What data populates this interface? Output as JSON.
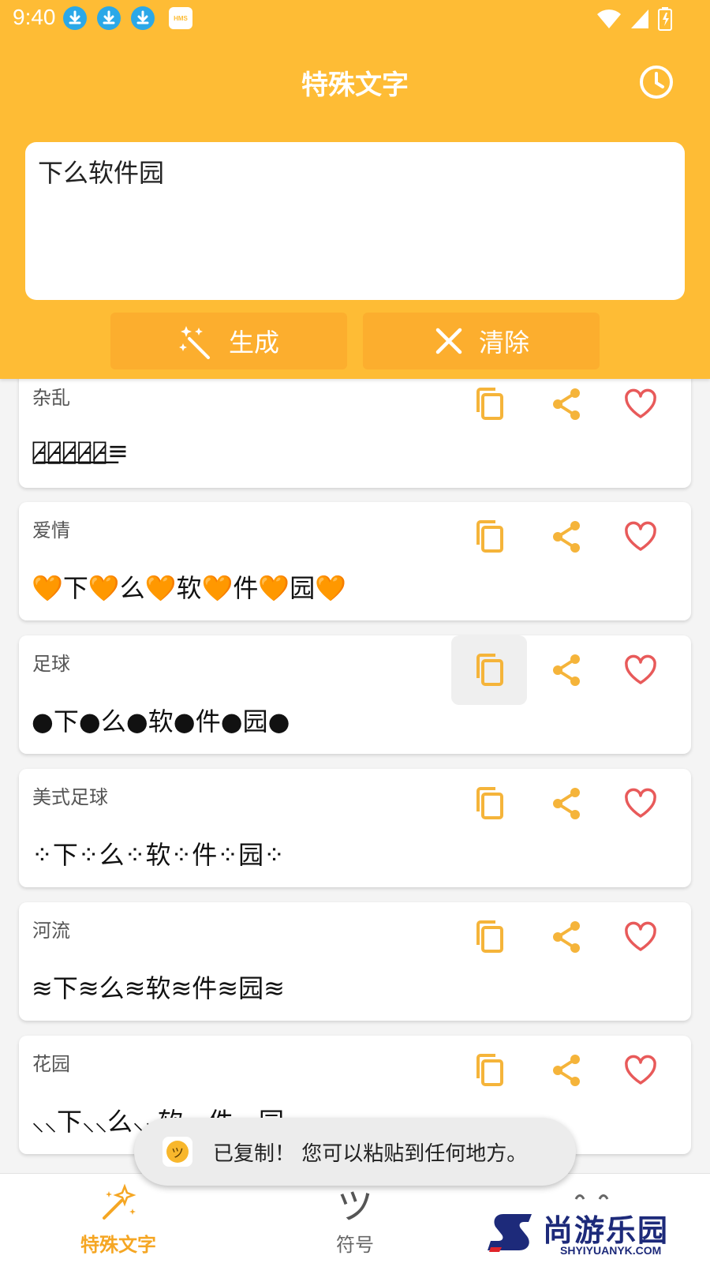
{
  "status_bar": {
    "time": "9:40",
    "hms_label": "HMS"
  },
  "header": {
    "title": "特殊文字"
  },
  "input": {
    "value": "下么软件园"
  },
  "actions": {
    "generate_label": "生成",
    "clear_label": "清除"
  },
  "cards": [
    {
      "label": "杂乱",
      "text": "下̷̵͟么̷̵͟软̷̵͟件̷̵͟园̷̵͟≡"
    },
    {
      "label": "爱情",
      "text": "🧡下🧡么🧡软🧡件🧡园🧡"
    },
    {
      "label": "足球",
      "text": "●下●么●软●件●园●"
    },
    {
      "label": "美式足球",
      "text": "⁘下⁘么⁘软⁘件⁘园⁘"
    },
    {
      "label": "河流",
      "text": "≋下≋么≋软≋件≋园≋"
    },
    {
      "label": "花园",
      "text": "⸜⸜下⸜⸜么⸜⸜软⸜⸜件⸜⸜园⸜⸜"
    }
  ],
  "toast": {
    "text": "已复制！ 您可以粘贴到任何地方。"
  },
  "bottom_nav": [
    {
      "label": "特殊文字",
      "active": true
    },
    {
      "label": "符号",
      "glyph": "ツ",
      "active": false
    },
    {
      "label": "",
      "active": false
    }
  ],
  "watermark": {
    "title": "尚游乐园",
    "url": "SHYIYUANYK.COM"
  },
  "colors": {
    "primary": "#FEBC35",
    "button": "#FCAE2E",
    "copy_icon": "#F5B43A",
    "share_icon": "#F5B43A",
    "heart_icon": "#E85A5A",
    "nav_active": "#F5A623",
    "status_download": "#2AA8E8"
  }
}
